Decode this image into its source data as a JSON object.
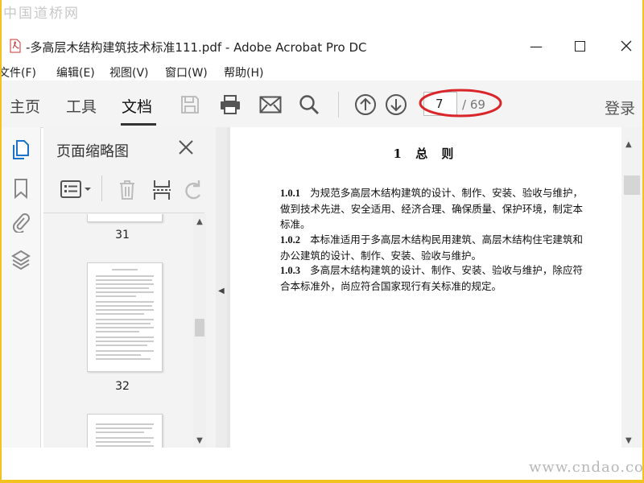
{
  "watermark_top": "中国道桥网",
  "watermark_bottom": "www.cndao.com",
  "window": {
    "title": "-多高层木结构建筑技术标准111.pdf - Adobe Acrobat Pro DC",
    "minimize": "—",
    "maximize": "☐",
    "close": "✕"
  },
  "menu": {
    "file": "文件(F)",
    "edit": "编辑(E)",
    "view": "视图(V)",
    "window": "窗口(W)",
    "help": "帮助(H)"
  },
  "toolbar": {
    "tab_home": "主页",
    "tab_tools": "工具",
    "tab_document": "文档",
    "current_page": "7",
    "total_pages": "/ 69",
    "login": "登录"
  },
  "thumbnail_pane": {
    "title": "页面缩略图",
    "pages": [
      {
        "number": "31"
      },
      {
        "number": "32"
      }
    ]
  },
  "document": {
    "heading": "1  总    则",
    "clauses": [
      {
        "num": "1.0.1",
        "text": "为规范多高层木结构建筑的设计、制作、安装、验收与维护，做到技术先进、安全适用、经济合理、确保质量、保护环境，制定本标准。"
      },
      {
        "num": "1.0.2",
        "text": "本标准适用于多高层木结构民用建筑、高层木结构住宅建筑和办公建筑的设计、制作、安装、验收与维护。"
      },
      {
        "num": "1.0.3",
        "text": "多高层木结构建筑的设计、制作、安装、验收与维护，除应符合本标准外，尚应符合国家现行有关标准的规定。"
      }
    ]
  },
  "colors": {
    "frame_border": "#f2c320",
    "highlight_ellipse": "#d9262a",
    "toolbar_bg": "#f4f4f4"
  },
  "icons": [
    "pdf-file-icon",
    "save-icon",
    "print-icon",
    "email-icon",
    "search-icon",
    "page-up-icon",
    "page-down-icon",
    "page-thumbnails-icon",
    "bookmark-icon",
    "attachment-icon",
    "layers-icon",
    "close-icon",
    "thumbnail-options-icon",
    "delete-icon",
    "insert-page-icon",
    "rotate-icon"
  ]
}
